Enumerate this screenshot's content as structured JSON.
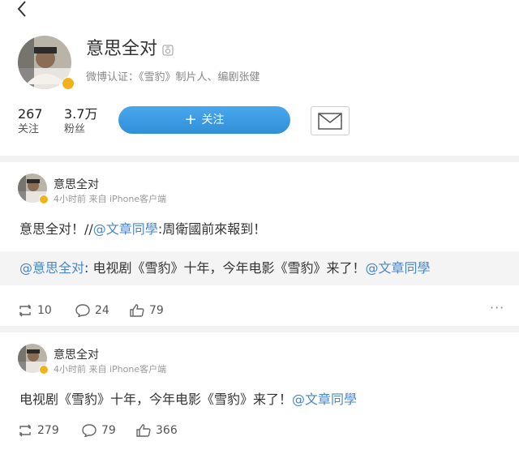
{
  "profile": {
    "name": "意思全对",
    "verify": "微博认证：《雪豹》制片人、编剧张健",
    "following_count": "267",
    "following_label": "关注",
    "followers_count": "3.7万",
    "followers_label": "粉丝",
    "follow_button": "关注"
  },
  "posts": [
    {
      "author": "意思全对",
      "meta": "4小时前 来自 iPhone客户端",
      "text_prefix": "意思全对！//",
      "text_mention": "@文章同學",
      "text_suffix": ":周衛國前來報到！",
      "repost": {
        "author_mention": "@意思全对",
        "text": ": 电视剧《雪豹》十年，今年电影《雪豹》来了！",
        "trailing_mention": "@文章同學"
      },
      "reposts": "10",
      "comments": "24",
      "likes": "79"
    },
    {
      "author": "意思全对",
      "meta": "4小时前 来自 iPhone客户端",
      "text": "电视剧《雪豹》十年，今年电影《雪豹》来了！",
      "text_mention": "@文章同學",
      "reposts": "279",
      "comments": "79",
      "likes": "366"
    }
  ],
  "icons": {
    "back": "back-arrow-icon",
    "message": "mail-icon",
    "repost": "repost-icon",
    "comment": "comment-icon",
    "like": "like-icon",
    "more": "more-icon"
  },
  "colors": {
    "accent": "#3a9be0",
    "mention": "#4a86c5",
    "verified_badge": "#f2b21b"
  }
}
